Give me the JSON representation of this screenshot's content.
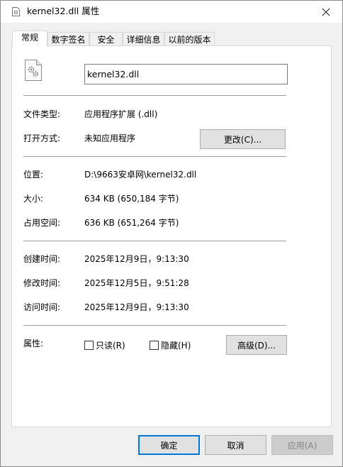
{
  "window": {
    "title": "kernel32.dll 属性",
    "close_glyph": "✕"
  },
  "tabs": [
    {
      "label": "常规",
      "active": true
    },
    {
      "label": "数字签名",
      "active": false
    },
    {
      "label": "安全",
      "active": false
    },
    {
      "label": "详细信息",
      "active": false
    },
    {
      "label": "以前的版本",
      "active": false
    }
  ],
  "general": {
    "file_name": "kernel32.dll",
    "type_label": "文件类型:",
    "type_value": "应用程序扩展 (.dll)",
    "opens_label": "打开方式:",
    "opens_value": "未知应用程序",
    "change_button": "更改(C)...",
    "location_label": "位置:",
    "location_value": "D:\\9663安卓网\\kernel32.dll",
    "size_label": "大小:",
    "size_value": "634 KB (650,184 字节)",
    "disk_label": "占用空间:",
    "disk_value": "636 KB (651,264 字节)",
    "created_label": "创建时间:",
    "created_value": "2025年12月9日，9:13:30",
    "modified_label": "修改时间:",
    "modified_value": "2025年12月5日，9:51:28",
    "accessed_label": "访问时间:",
    "accessed_value": "2025年12月9日，9:13:30",
    "attributes_label": "属性:",
    "readonly_label": "只读(R)",
    "hidden_label": "隐藏(H)",
    "advanced_button": "高级(D)..."
  },
  "footer": {
    "ok": "确定",
    "cancel": "取消",
    "apply": "应用(A)"
  },
  "colors": {
    "accent": "#0078d7",
    "separator": "#a0a0a0",
    "button_bg": "#e1e1e1"
  }
}
